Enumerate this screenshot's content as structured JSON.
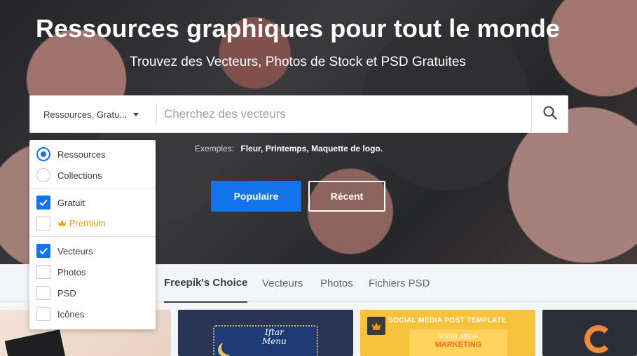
{
  "hero": {
    "title": "Ressources graphiques pour tout le monde",
    "subtitle": "Trouvez des Vecteurs, Photos de Stock et PSD Gratuites"
  },
  "search": {
    "scope_label": "Ressources, Gratu...",
    "placeholder": "Cherchez des vecteurs"
  },
  "examples": {
    "label": "Exemples:",
    "items": [
      "Fleur,",
      "Printemps,",
      "Maquette de logo."
    ]
  },
  "buttons": {
    "popular": "Populaire",
    "recent": "Récent"
  },
  "dropdown": {
    "types": [
      {
        "label": "Ressources",
        "checked": true
      },
      {
        "label": "Collections",
        "checked": false
      }
    ],
    "license": [
      {
        "label": "Gratuit",
        "checked": true
      },
      {
        "label": "Premium",
        "checked": false
      }
    ],
    "formats": [
      {
        "label": "Vecteurs",
        "checked": true
      },
      {
        "label": "Photos",
        "checked": false
      },
      {
        "label": "PSD",
        "checked": false
      },
      {
        "label": "Icônes",
        "checked": false
      }
    ]
  },
  "tabs": [
    {
      "label": "Freepik's Choice",
      "active": true
    },
    {
      "label": "Vecteurs",
      "active": false
    },
    {
      "label": "Photos",
      "active": false
    },
    {
      "label": "Fichiers PSD",
      "active": false
    }
  ],
  "cards": {
    "card2_text_line1": "Iftar",
    "card2_text_line2": "Menu",
    "card3_title": "SOCIAL MEDIA POST TEMPLATE",
    "card3_inner_line1": "SOCIAL MEDIA",
    "card3_inner_line2": "MARKETING"
  },
  "colors": {
    "accent": "#1273eb",
    "premium": "#f2a10d"
  }
}
